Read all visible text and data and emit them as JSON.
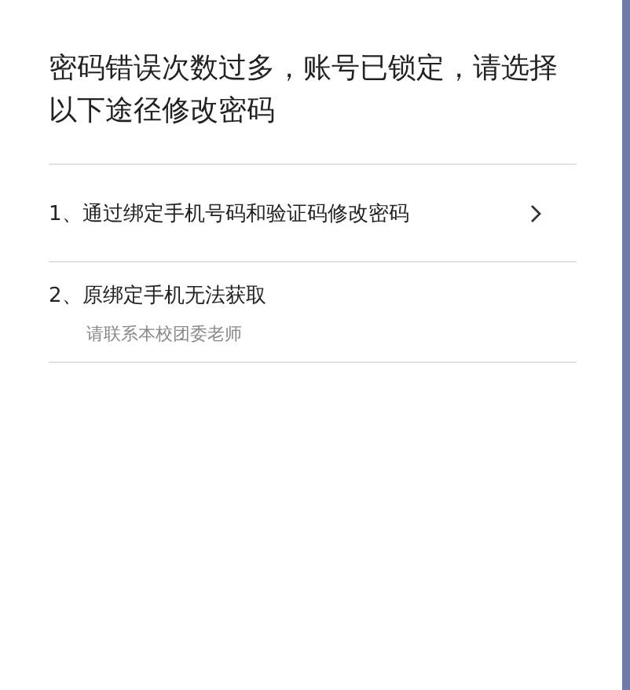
{
  "title": "密码错误次数过多，账号已锁定，请选择以下途径修改密码",
  "options": [
    {
      "label": "1、通过绑定手机号码和验证码修改密码",
      "kind": "link"
    },
    {
      "label": "2、原绑定手机无法获取",
      "kind": "note",
      "hint": "请联系本校团委老师"
    }
  ]
}
